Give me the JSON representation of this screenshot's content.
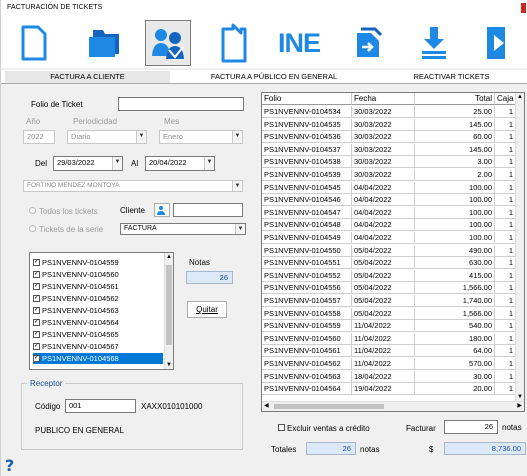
{
  "window": {
    "title": "FACTURACIÓN DE TICKETS"
  },
  "toolbar": {
    "buttons": [
      {
        "name": "new-document",
        "icon": "document-icon"
      },
      {
        "name": "open-folder",
        "icon": "folder-icon"
      },
      {
        "name": "clients",
        "icon": "people-icon"
      },
      {
        "name": "print",
        "icon": "printer-icon"
      },
      {
        "name": "ine",
        "icon": "ine-icon",
        "label": "INE"
      },
      {
        "name": "export",
        "icon": "export-icon"
      },
      {
        "name": "download",
        "icon": "download-icon"
      },
      {
        "name": "exit",
        "icon": "exit-icon"
      }
    ]
  },
  "tabs": [
    "FACTURA A CLIENTE",
    "FACTURA A PÚBLICO EN GENERAL",
    "REACTIVAR TICKETS"
  ],
  "form": {
    "folio_label": "Folio de Ticket",
    "folio_value": "",
    "anio_label": "Año",
    "anio_value": "2022",
    "periodicidad_label": "Periodicidad",
    "periodicidad_value": "Diario",
    "mes_label": "Mes",
    "mes_value": "Enero",
    "del_label": "Del",
    "del_value": "29/03/2022",
    "al_label": "Al",
    "al_value": "20/04/2022",
    "vendedor_value": "FORTINO MENDEZ MONTOYA",
    "todos_label": "Todos los tickets",
    "cliente_label": "Cliente",
    "cliente_value": "",
    "serie_label": "Tickets de la serie",
    "serie_value": "FACTURA",
    "notas_label": "Notas",
    "notas_value": "26",
    "quitar_label": "Quitar"
  },
  "ticket_list": [
    "PS1NVENNV-0104559",
    "PS1NVENNV-0104560",
    "PS1NVENNV-0104561",
    "PS1NVENNV-0104562",
    "PS1NVENNV-0104563",
    "PS1NVENNV-0104564",
    "PS1NVENNV-0104565",
    "PS1NVENNV-0104567",
    "PS1NVENNV-0104568"
  ],
  "receptor": {
    "title": "Receptor",
    "codigo_label": "Código",
    "codigo_value": "001",
    "rfc": "XAXX010101000",
    "nombre": "PUBLICO EN GENERAL"
  },
  "grid": {
    "headers": [
      "Folio",
      "Fecha",
      "Total",
      "Caja"
    ],
    "rows": [
      [
        "PS1NVENNV-0104534",
        "30/03/2022",
        "25.00",
        "1"
      ],
      [
        "PS1NVENNV-0104535",
        "30/03/2022",
        "145.00",
        "1"
      ],
      [
        "PS1NVENNV-0104536",
        "30/03/2022",
        "60.00",
        "1"
      ],
      [
        "PS1NVENNV-0104537",
        "30/03/2022",
        "145.00",
        "1"
      ],
      [
        "PS1NVENNV-0104538",
        "30/03/2022",
        "3.00",
        "1"
      ],
      [
        "PS1NVENNV-0104539",
        "30/03/2022",
        "2.00",
        "1"
      ],
      [
        "PS1NVENNV-0104545",
        "04/04/2022",
        "100.00",
        "1"
      ],
      [
        "PS1NVENNV-0104546",
        "04/04/2022",
        "100.00",
        "1"
      ],
      [
        "PS1NVENNV-0104547",
        "04/04/2022",
        "100.00",
        "1"
      ],
      [
        "PS1NVENNV-0104548",
        "04/04/2022",
        "100.00",
        "1"
      ],
      [
        "PS1NVENNV-0104549",
        "04/04/2022",
        "100.00",
        "1"
      ],
      [
        "PS1NVENNV-0104550",
        "05/04/2022",
        "490.00",
        "1"
      ],
      [
        "PS1NVENNV-0104551",
        "05/04/2022",
        "630.00",
        "1"
      ],
      [
        "PS1NVENNV-0104552",
        "05/04/2022",
        "415.00",
        "1"
      ],
      [
        "PS1NVENNV-0104556",
        "05/04/2022",
        "1,566.00",
        "1"
      ],
      [
        "PS1NVENNV-0104557",
        "05/04/2022",
        "1,740.00",
        "1"
      ],
      [
        "PS1NVENNV-0104558",
        "05/04/2022",
        "1,566.00",
        "1"
      ],
      [
        "PS1NVENNV-0104559",
        "11/04/2022",
        "540.00",
        "1"
      ],
      [
        "PS1NVENNV-0104560",
        "11/04/2022",
        "180.00",
        "1"
      ],
      [
        "PS1NVENNV-0104561",
        "11/04/2022",
        "64.00",
        "1"
      ],
      [
        "PS1NVENNV-0104562",
        "11/04/2022",
        "570.00",
        "1"
      ],
      [
        "PS1NVENNV-0104563",
        "18/04/2022",
        "30.00",
        "1"
      ],
      [
        "PS1NVENNV-0104564",
        "19/04/2022",
        "20.00",
        "1"
      ]
    ]
  },
  "footer": {
    "excluir_label": "Excluir ventas a crédito",
    "facturar_label": "Facturar",
    "facturar_value": "26",
    "notas_suffix": "notas",
    "totales_label": "Totales",
    "totales_count": "26",
    "totales_suffix": "notas",
    "currency_symbol": "$",
    "total_amount": "8,736.00"
  },
  "colors": {
    "accent": "#0078d7",
    "icon_blue": "#1e88e5",
    "label_blue": "#1b4e9b"
  }
}
